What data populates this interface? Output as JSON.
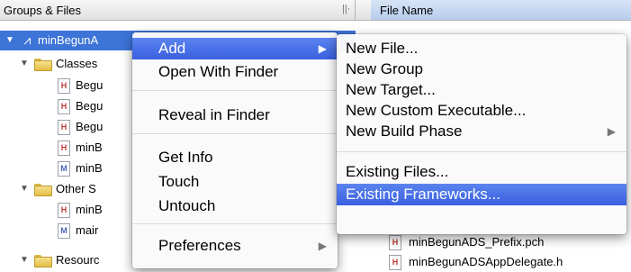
{
  "headers": {
    "groups_files": "Groups & Files",
    "file_name": "File Name",
    "split_handle": "||·"
  },
  "tree": {
    "project_label": "minBegunA",
    "classes_label": "Classes",
    "classes_items": [
      {
        "badge": "H",
        "label": "Begu"
      },
      {
        "badge": "H",
        "label": "Begu"
      },
      {
        "badge": "H",
        "label": "Begu"
      },
      {
        "badge": "H",
        "label": "minB"
      },
      {
        "badge": "M",
        "label": "minB"
      }
    ],
    "other_label": "Other S",
    "other_items": [
      {
        "badge": "H",
        "label": "minB"
      },
      {
        "badge": "M",
        "label": "mair"
      }
    ],
    "resources_label": "Resourc"
  },
  "file_pane": {
    "rows": [
      {
        "badge": "H",
        "label": "minBegunADS_Prefix.pch"
      },
      {
        "badge": "H",
        "label": "minBegunADSAppDelegate.h"
      }
    ]
  },
  "context_menu": {
    "add": "Add",
    "open_with_finder": "Open With Finder",
    "reveal_in_finder": "Reveal in Finder",
    "get_info": "Get Info",
    "touch": "Touch",
    "untouch": "Untouch",
    "preferences": "Preferences",
    "submenu_arrow": "▶"
  },
  "submenu": {
    "new_file": "New File...",
    "new_group": "New Group",
    "new_target": "New Target...",
    "new_custom_executable": "New Custom Executable...",
    "new_build_phase": "New Build Phase",
    "existing_files": "Existing Files...",
    "existing_frameworks": "Existing Frameworks...",
    "submenu_arrow": "▶"
  },
  "colors": {
    "selection": "#3d74d8",
    "menu_highlight": "#3a5fe0",
    "folder": "#e4be47"
  },
  "icons": {
    "disclosure_open": "▼",
    "project": "⩘"
  }
}
